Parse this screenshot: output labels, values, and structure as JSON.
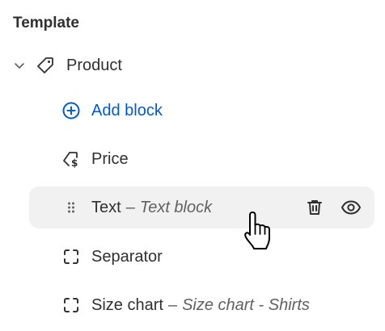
{
  "section": {
    "title": "Template"
  },
  "tree": {
    "parent": {
      "label": "Product",
      "icon": "tag-icon",
      "expanded": true
    },
    "add_block": {
      "label": "Add block",
      "icon": "plus-circle-icon",
      "color": "#005bd3"
    },
    "blocks": [
      {
        "label": "Price",
        "icon": "price-tag-icon",
        "subtitle": ""
      },
      {
        "label": "Text",
        "icon": "drag-handle-icon",
        "subtitle": "Text block",
        "dash": "–",
        "hovered": true
      },
      {
        "label": "Separator",
        "icon": "block-frame-icon",
        "subtitle": ""
      },
      {
        "label": "Size chart",
        "icon": "block-frame-icon",
        "subtitle": "Size chart - Shirts",
        "dash": "–"
      }
    ]
  },
  "actions": {
    "delete_icon": "trash-icon",
    "visibility_icon": "eye-icon"
  },
  "cursor": "hand-pointer-icon",
  "colors": {
    "hover_bg": "#f1f1f1",
    "text": "#303030",
    "muted": "#616161",
    "accent": "#005bd3"
  }
}
